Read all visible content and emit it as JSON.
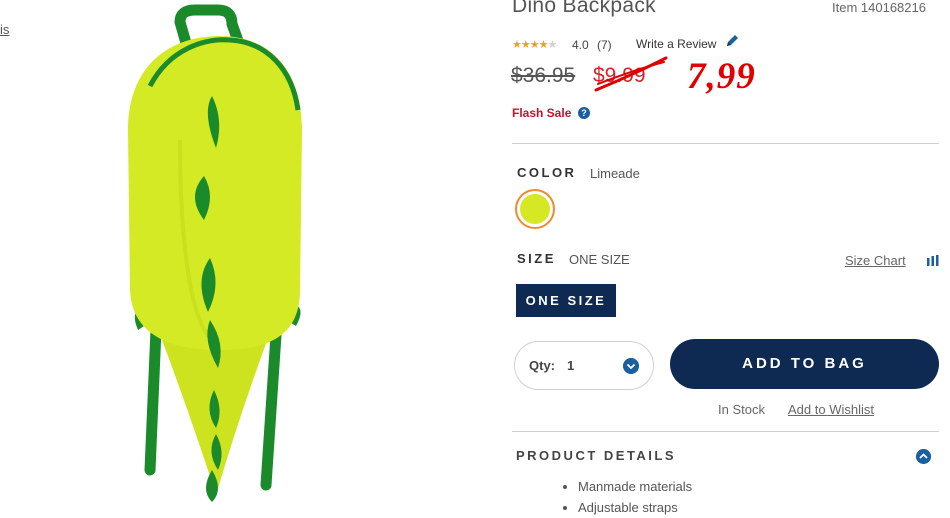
{
  "fragment_link": "is",
  "product": {
    "title": "Dino Backpack",
    "item_number": "Item 140168216"
  },
  "rating": {
    "stars": 4,
    "value": "4.0",
    "count": "(7)",
    "write_review": "Write a Review",
    "pencil_icon": "pencil-icon"
  },
  "price": {
    "original": "$36.95",
    "sale": "$9.99",
    "handwritten": "7,99",
    "handwritten_color": "#e00000",
    "flash_sale": "Flash Sale",
    "help_icon": "?"
  },
  "color": {
    "label": "COLOR",
    "value": "Limeade",
    "swatch_color": "#d6e823"
  },
  "size": {
    "label": "SIZE",
    "value": "ONE SIZE",
    "chart_link": "Size Chart",
    "option": "ONE SIZE"
  },
  "cart": {
    "qty_label": "Qty:",
    "qty_value": "1",
    "add_to_bag": "ADD TO BAG",
    "button_color": "#0f2a52"
  },
  "availability": {
    "status": "In Stock",
    "wishlist": "Add to Wishlist"
  },
  "details": {
    "heading": "PRODUCT DETAILS",
    "items": [
      "Manmade materials",
      "Adjustable straps"
    ]
  }
}
